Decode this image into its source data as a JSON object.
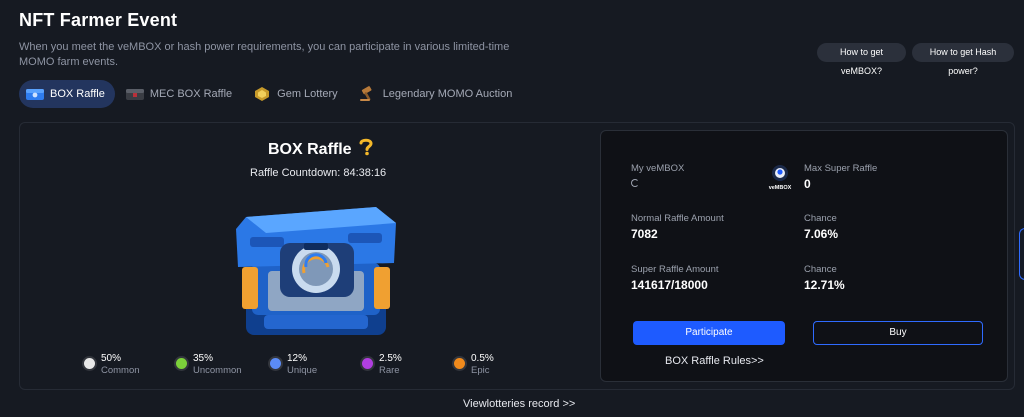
{
  "header": {
    "title": "NFT Farmer Event",
    "description": "When you meet the veMBOX or hash power requirements, you can participate in various limited-time MOMO farm events.",
    "help_vembox": "How to get veMBOX?",
    "help_hash": "How to get Hash power?"
  },
  "tabs": [
    {
      "label": "BOX Raffle",
      "icon": "blue-box-icon",
      "active": true
    },
    {
      "label": "MEC BOX Raffle",
      "icon": "mec-box-icon",
      "active": false
    },
    {
      "label": "Gem Lottery",
      "icon": "gem-icon",
      "active": false
    },
    {
      "label": "Legendary MOMO Auction",
      "icon": "gavel-icon",
      "active": false
    }
  ],
  "raffle": {
    "title": "BOX Raffle",
    "countdown": "Raffle Countdown: 84:38:16",
    "rarities": [
      {
        "pct": "50%",
        "name": "Common",
        "color": "#e8e8e8"
      },
      {
        "pct": "35%",
        "name": "Uncommon",
        "color": "#7cd13a"
      },
      {
        "pct": "12%",
        "name": "Unique",
        "color": "#5b8bf5"
      },
      {
        "pct": "2.5%",
        "name": "Rare",
        "color": "#b13fe0"
      },
      {
        "pct": "0.5%",
        "name": "Epic",
        "color": "#f08a1c"
      }
    ]
  },
  "stats": {
    "my_vembox_label": "My veMBOX",
    "vembox_logo_text": "veMBOX",
    "max_super_label": "Max Super Raffle",
    "max_super_value": "0",
    "normal_label": "Normal Raffle Amount",
    "normal_value": "7082",
    "chance1_label": "Chance",
    "chance1_value": "7.06%",
    "super_label": "Super Raffle Amount",
    "super_value": "141617/18000",
    "chance2_label": "Chance",
    "chance2_value": "12.71%",
    "participate": "Participate",
    "buy": "Buy",
    "rules": "BOX Raffle Rules>>"
  },
  "footer": {
    "view_record": "Viewlotteries record >>"
  },
  "colors": {
    "accent": "#1e5bff",
    "active_tab": "#23355e",
    "background": "#161a22"
  }
}
